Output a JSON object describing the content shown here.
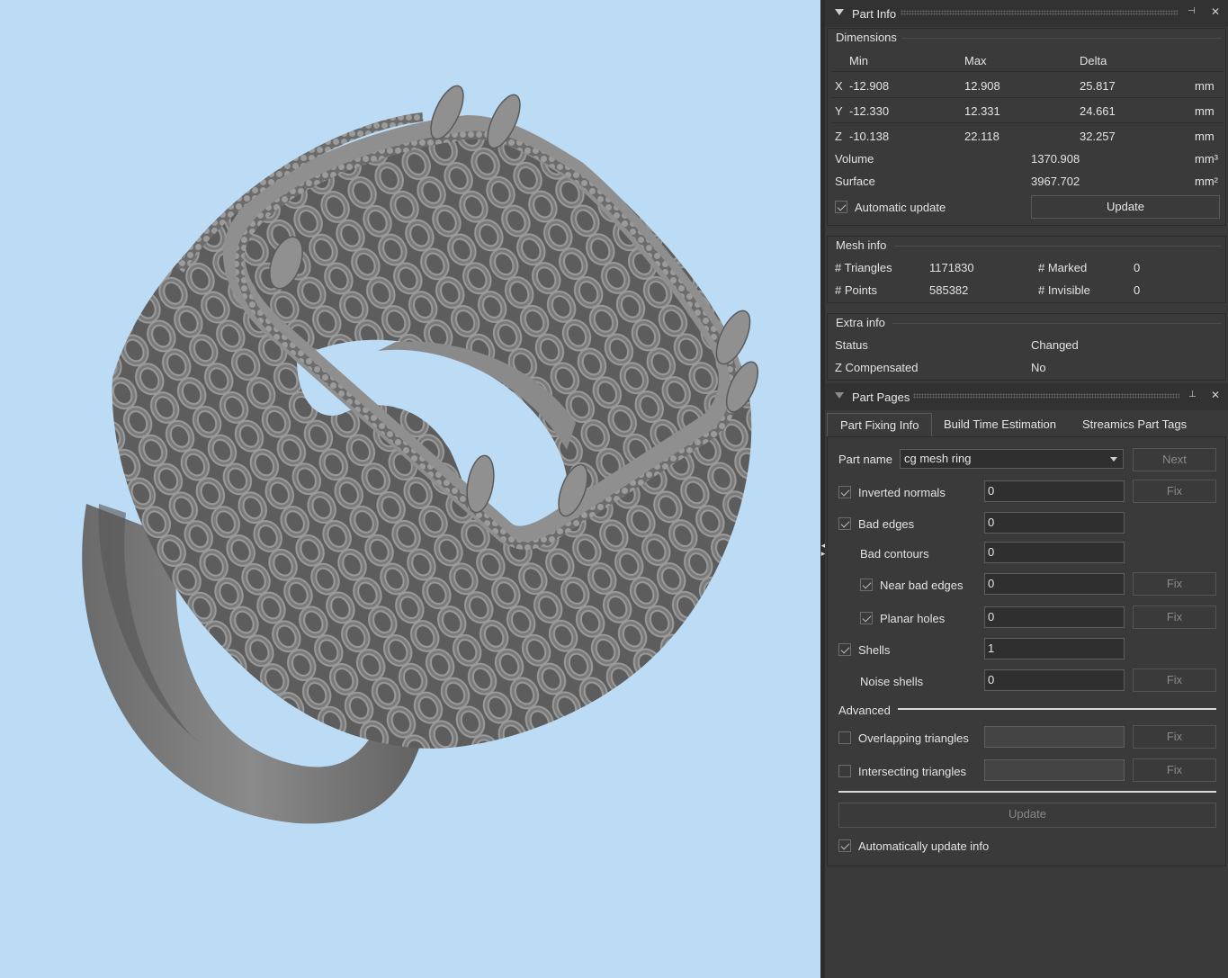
{
  "part_info": {
    "title": "Part Info",
    "dimensions": {
      "title": "Dimensions",
      "headers": [
        "Min",
        "Max",
        "Delta"
      ],
      "rows": [
        {
          "axis": "X",
          "min": "-12.908",
          "max": "12.908",
          "delta": "25.817",
          "unit": "mm"
        },
        {
          "axis": "Y",
          "min": "-12.330",
          "max": "12.331",
          "delta": "24.661",
          "unit": "mm"
        },
        {
          "axis": "Z",
          "min": "-10.138",
          "max": "22.118",
          "delta": "32.257",
          "unit": "mm"
        }
      ],
      "volume_label": "Volume",
      "volume_value": "1370.908",
      "volume_unit": "mm³",
      "surface_label": "Surface",
      "surface_value": "3967.702",
      "surface_unit": "mm²",
      "auto_update_label": "Automatic update",
      "auto_update_checked": true,
      "update_button": "Update"
    },
    "mesh_info": {
      "title": "Mesh info",
      "triangles_label": "# Triangles",
      "triangles_value": "1171830",
      "marked_label": "# Marked",
      "marked_value": "0",
      "points_label": "# Points",
      "points_value": "585382",
      "invisible_label": "# Invisible",
      "invisible_value": "0"
    },
    "extra_info": {
      "title": "Extra info",
      "status_label": "Status",
      "status_value": "Changed",
      "zcomp_label": "Z Compensated",
      "zcomp_value": "No"
    }
  },
  "part_pages": {
    "title": "Part Pages",
    "tabs": [
      "Part Fixing Info",
      "Build Time Estimation",
      "Streamics Part Tags"
    ],
    "part_name_label": "Part name",
    "part_name_value": "cg mesh ring",
    "next_button": "Next",
    "fix_label": "Fix",
    "rows": {
      "inverted_normals": {
        "label": "Inverted normals",
        "value": "0",
        "checked": true
      },
      "bad_edges": {
        "label": "Bad edges",
        "value": "0",
        "checked": true
      },
      "bad_contours": {
        "label": "Bad contours",
        "value": "0"
      },
      "near_bad_edges": {
        "label": "Near bad edges",
        "value": "0",
        "checked": true
      },
      "planar_holes": {
        "label": "Planar holes",
        "value": "0",
        "checked": true
      },
      "shells": {
        "label": "Shells",
        "value": "1",
        "checked": true
      },
      "noise_shells": {
        "label": "Noise shells",
        "value": "0"
      },
      "overlapping": {
        "label": "Overlapping triangles",
        "value": "",
        "checked": false
      },
      "intersecting": {
        "label": "Intersecting triangles",
        "value": "",
        "checked": false
      }
    },
    "advanced_label": "Advanced",
    "update_button": "Update",
    "auto_update_info_label": "Automatically update info",
    "auto_update_info_checked": true
  },
  "colors": {
    "viewport_bg": "#bcdcf6",
    "panel_bg": "#3a3a3a",
    "model_gray": "#7b7b7b"
  }
}
